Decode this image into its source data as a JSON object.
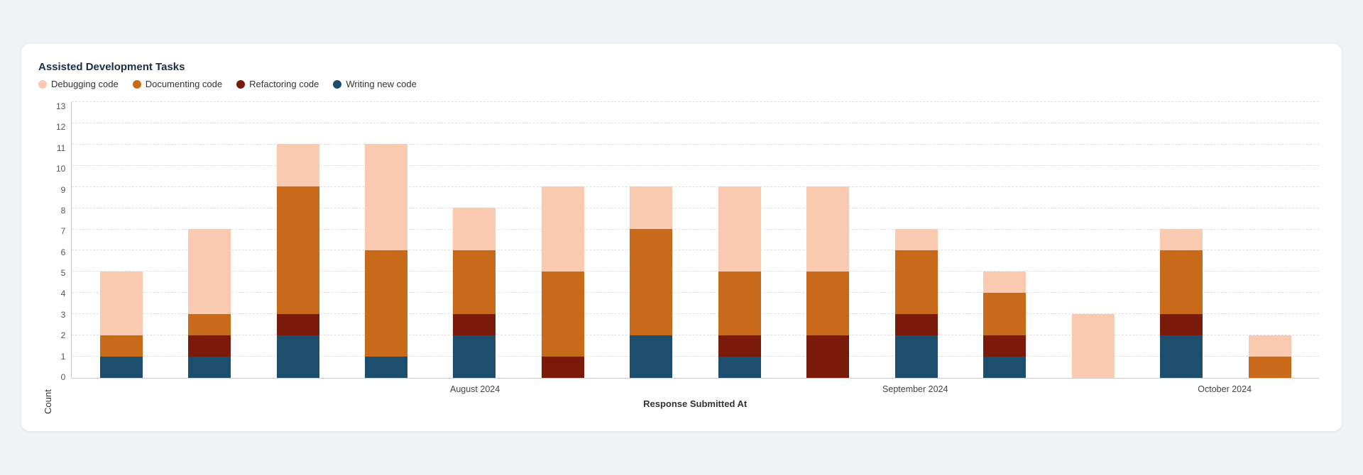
{
  "chart": {
    "title": "Assisted Development Tasks",
    "x_axis_label": "Response Submitted At",
    "y_axis_label": "Count",
    "legend": [
      {
        "id": "debugging",
        "label": "Debugging code",
        "color": "#f9c9b0"
      },
      {
        "id": "documenting",
        "label": "Documenting code",
        "color": "#c96a1a"
      },
      {
        "id": "refactoring",
        "label": "Refactoring code",
        "color": "#7a1a0a"
      },
      {
        "id": "writing",
        "label": "Writing new code",
        "color": "#1e4e6e"
      }
    ],
    "y_ticks": [
      0,
      1,
      2,
      3,
      4,
      5,
      6,
      7,
      8,
      9,
      10,
      11,
      12,
      13
    ],
    "y_max": 13,
    "months": [
      {
        "label": "",
        "bars_count": 2
      },
      {
        "label": "August 2024",
        "bars_count": 5
      },
      {
        "label": "September 2024",
        "bars_count": 5
      },
      {
        "label": "October 2024",
        "bars_count": 2
      }
    ],
    "bars": [
      {
        "month_group": "",
        "debugging": 3,
        "documenting": 1,
        "refactoring": 0,
        "writing": 1
      },
      {
        "month_group": "",
        "debugging": 4,
        "documenting": 1,
        "refactoring": 1,
        "writing": 1
      },
      {
        "month_group": "August 2024",
        "debugging": 2,
        "documenting": 6,
        "refactoring": 1,
        "writing": 2
      },
      {
        "month_group": "August 2024",
        "debugging": 5,
        "documenting": 5,
        "refactoring": 0,
        "writing": 1
      },
      {
        "month_group": "August 2024",
        "debugging": 2,
        "documenting": 3,
        "refactoring": 1,
        "writing": 2
      },
      {
        "month_group": "August 2024",
        "debugging": 4,
        "documenting": 4,
        "refactoring": 1,
        "writing": 0
      },
      {
        "month_group": "August 2024",
        "debugging": 2,
        "documenting": 5,
        "refactoring": 0,
        "writing": 2
      },
      {
        "month_group": "September 2024",
        "debugging": 4,
        "documenting": 3,
        "refactoring": 1,
        "writing": 1
      },
      {
        "month_group": "September 2024",
        "debugging": 4,
        "documenting": 3,
        "refactoring": 2,
        "writing": 0
      },
      {
        "month_group": "September 2024",
        "debugging": 1,
        "documenting": 3,
        "refactoring": 1,
        "writing": 2
      },
      {
        "month_group": "September 2024",
        "debugging": 1,
        "documenting": 2,
        "refactoring": 1,
        "writing": 1
      },
      {
        "month_group": "September 2024",
        "debugging": 3,
        "documenting": 0,
        "refactoring": 0,
        "writing": 0
      },
      {
        "month_group": "October 2024",
        "debugging": 1,
        "documenting": 3,
        "refactoring": 1,
        "writing": 2
      },
      {
        "month_group": "October 2024",
        "debugging": 1,
        "documenting": 1,
        "refactoring": 0,
        "writing": 0
      }
    ]
  }
}
